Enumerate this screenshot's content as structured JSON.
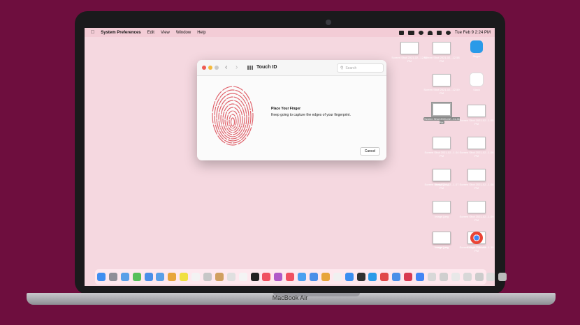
{
  "menubar": {
    "apple_icon": "apple-logo-icon",
    "app_name": "System Preferences",
    "items": [
      "Edit",
      "View",
      "Window",
      "Help"
    ],
    "clock": "Tue Feb 9  2:24 PM"
  },
  "window": {
    "title": "Touch ID",
    "search_placeholder": "Search",
    "heading": "Place Your Finger",
    "instruction": "Keep going to capture the edges of your fingerprint.",
    "cancel_label": "Cancel",
    "traffic_colors": [
      "#ee5b52",
      "#f5b93b",
      "#c9c9c9"
    ],
    "fingerprint_color": "#e0636c"
  },
  "desktop_icons": [
    {
      "label": "Screen Shot\n2021-02...12.57 PM",
      "kind": "thumb"
    },
    {
      "label": "Screen Shot\n2021-02...12.58 PM",
      "kind": "thumb"
    },
    {
      "label": "Skype",
      "kind": "app"
    },
    {
      "label": "Screen Shot\n2021-02...12.59 PM",
      "kind": "thumb"
    },
    {
      "label": "Slack",
      "kind": "app"
    },
    {
      "label": "Screen Shot\n2021-02...1.04 PM",
      "kind": "thumb"
    },
    {
      "label": "Screen Shot\n2021-02...11.41 PM",
      "kind": "thumb",
      "selected": true
    },
    {
      "label": "Screen Shot\n2021-02...1.05 PM",
      "kind": "thumb"
    },
    {
      "label": "Screen Shot\n2021-02...1.06 PM",
      "kind": "thumb"
    },
    {
      "label": "Screen Shot\n2021-02...1.07 PM",
      "kind": "thumb"
    },
    {
      "label": "Image.jpeg",
      "kind": "thumb"
    },
    {
      "label": "Screen Shot\n2021-02...1.08 PM",
      "kind": "thumb"
    },
    {
      "label": "Image.jpeg",
      "kind": "thumb"
    },
    {
      "label": "Screen Shot\n2021-02...1.09 PM",
      "kind": "thumb"
    },
    {
      "label": "Image.jpeg",
      "kind": "thumb"
    },
    {
      "label": "Screen Shot\n2021-02...1.10 PM",
      "kind": "thumb"
    },
    {
      "label": "Image.jpeg",
      "kind": "thumb"
    },
    {
      "label": "Google Chrome",
      "kind": "app"
    }
  ],
  "dock_colors": [
    "#3f8ef0",
    "#8f8f98",
    "#5aa0e8",
    "#57c05a",
    "#4a8fe8",
    "#5aa0e8",
    "#e7a53b",
    "#f0e040",
    "#f3f3f3",
    "#c7c7c7",
    "#d0a060",
    "#e0e0e0",
    "#f4f4f4",
    "#222222",
    "#f05060",
    "#b05ac8",
    "#f05060",
    "#4aa0f0",
    "#4a8fe8",
    "#e7a53b",
    "#f0f0f0",
    "#3a8ef0",
    "#303030",
    "#2a9ae8",
    "#e04848",
    "#4a8fe8",
    "#d83a52",
    "#4285f4",
    "#d8d8d8",
    "#cfcfcf",
    "#e8e8e8",
    "#d8d8d8",
    "#cccccc",
    "#dcdcdc",
    "#bbbbbb"
  ],
  "laptop": {
    "brand": "MacBook Air"
  }
}
